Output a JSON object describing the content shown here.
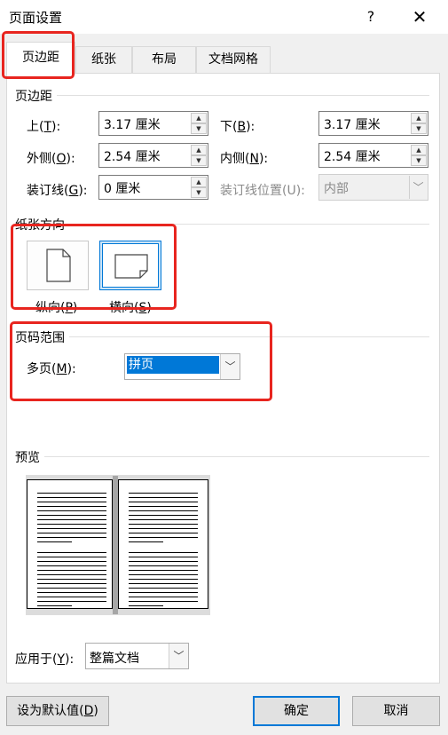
{
  "window": {
    "title": "页面设置",
    "help_label": "?",
    "close_label": "✕"
  },
  "tabs": [
    {
      "label": "页边距",
      "active": true
    },
    {
      "label": "纸张",
      "active": false
    },
    {
      "label": "布局",
      "active": false
    },
    {
      "label": "文档网格",
      "active": false
    }
  ],
  "margins": {
    "group_title": "页边距",
    "top": {
      "label": "上(",
      "key": "T",
      "suffix": "):",
      "value": "3.17 厘米"
    },
    "bottom": {
      "label": "下(",
      "key": "B",
      "suffix": "):",
      "value": "3.17 厘米"
    },
    "outside": {
      "label": "外侧(",
      "key": "O",
      "suffix": "):",
      "value": "2.54 厘米"
    },
    "inside": {
      "label": "内侧(",
      "key": "N",
      "suffix": "):",
      "value": "2.54 厘米"
    },
    "gutter": {
      "label": "装订线(",
      "key": "G",
      "suffix": "):",
      "value": "0 厘米"
    },
    "gutter_position": {
      "label": "装订线位置(U):",
      "value": "内部",
      "disabled": true
    }
  },
  "orientation": {
    "group_title": "纸张方向",
    "portrait": {
      "label": "纵向(",
      "key": "P",
      "suffix": ")",
      "selected": false
    },
    "landscape": {
      "label": "横向(",
      "key": "S",
      "suffix": ")",
      "selected": true
    }
  },
  "pages": {
    "group_title": "页码范围",
    "multiple": {
      "label": "多页(",
      "key": "M",
      "suffix": "):",
      "value": "拼页"
    }
  },
  "preview": {
    "group_title": "预览"
  },
  "apply_to": {
    "label": "应用于(",
    "key": "Y",
    "suffix": "):",
    "value": "整篇文档"
  },
  "buttons": {
    "default": {
      "label": "设为默认值(",
      "key": "D",
      "suffix": ")"
    },
    "ok": "确定",
    "cancel": "取消"
  },
  "colors": {
    "accent": "#0078d7",
    "highlight_box": "#e8251f",
    "background": "#f0f0f0"
  }
}
